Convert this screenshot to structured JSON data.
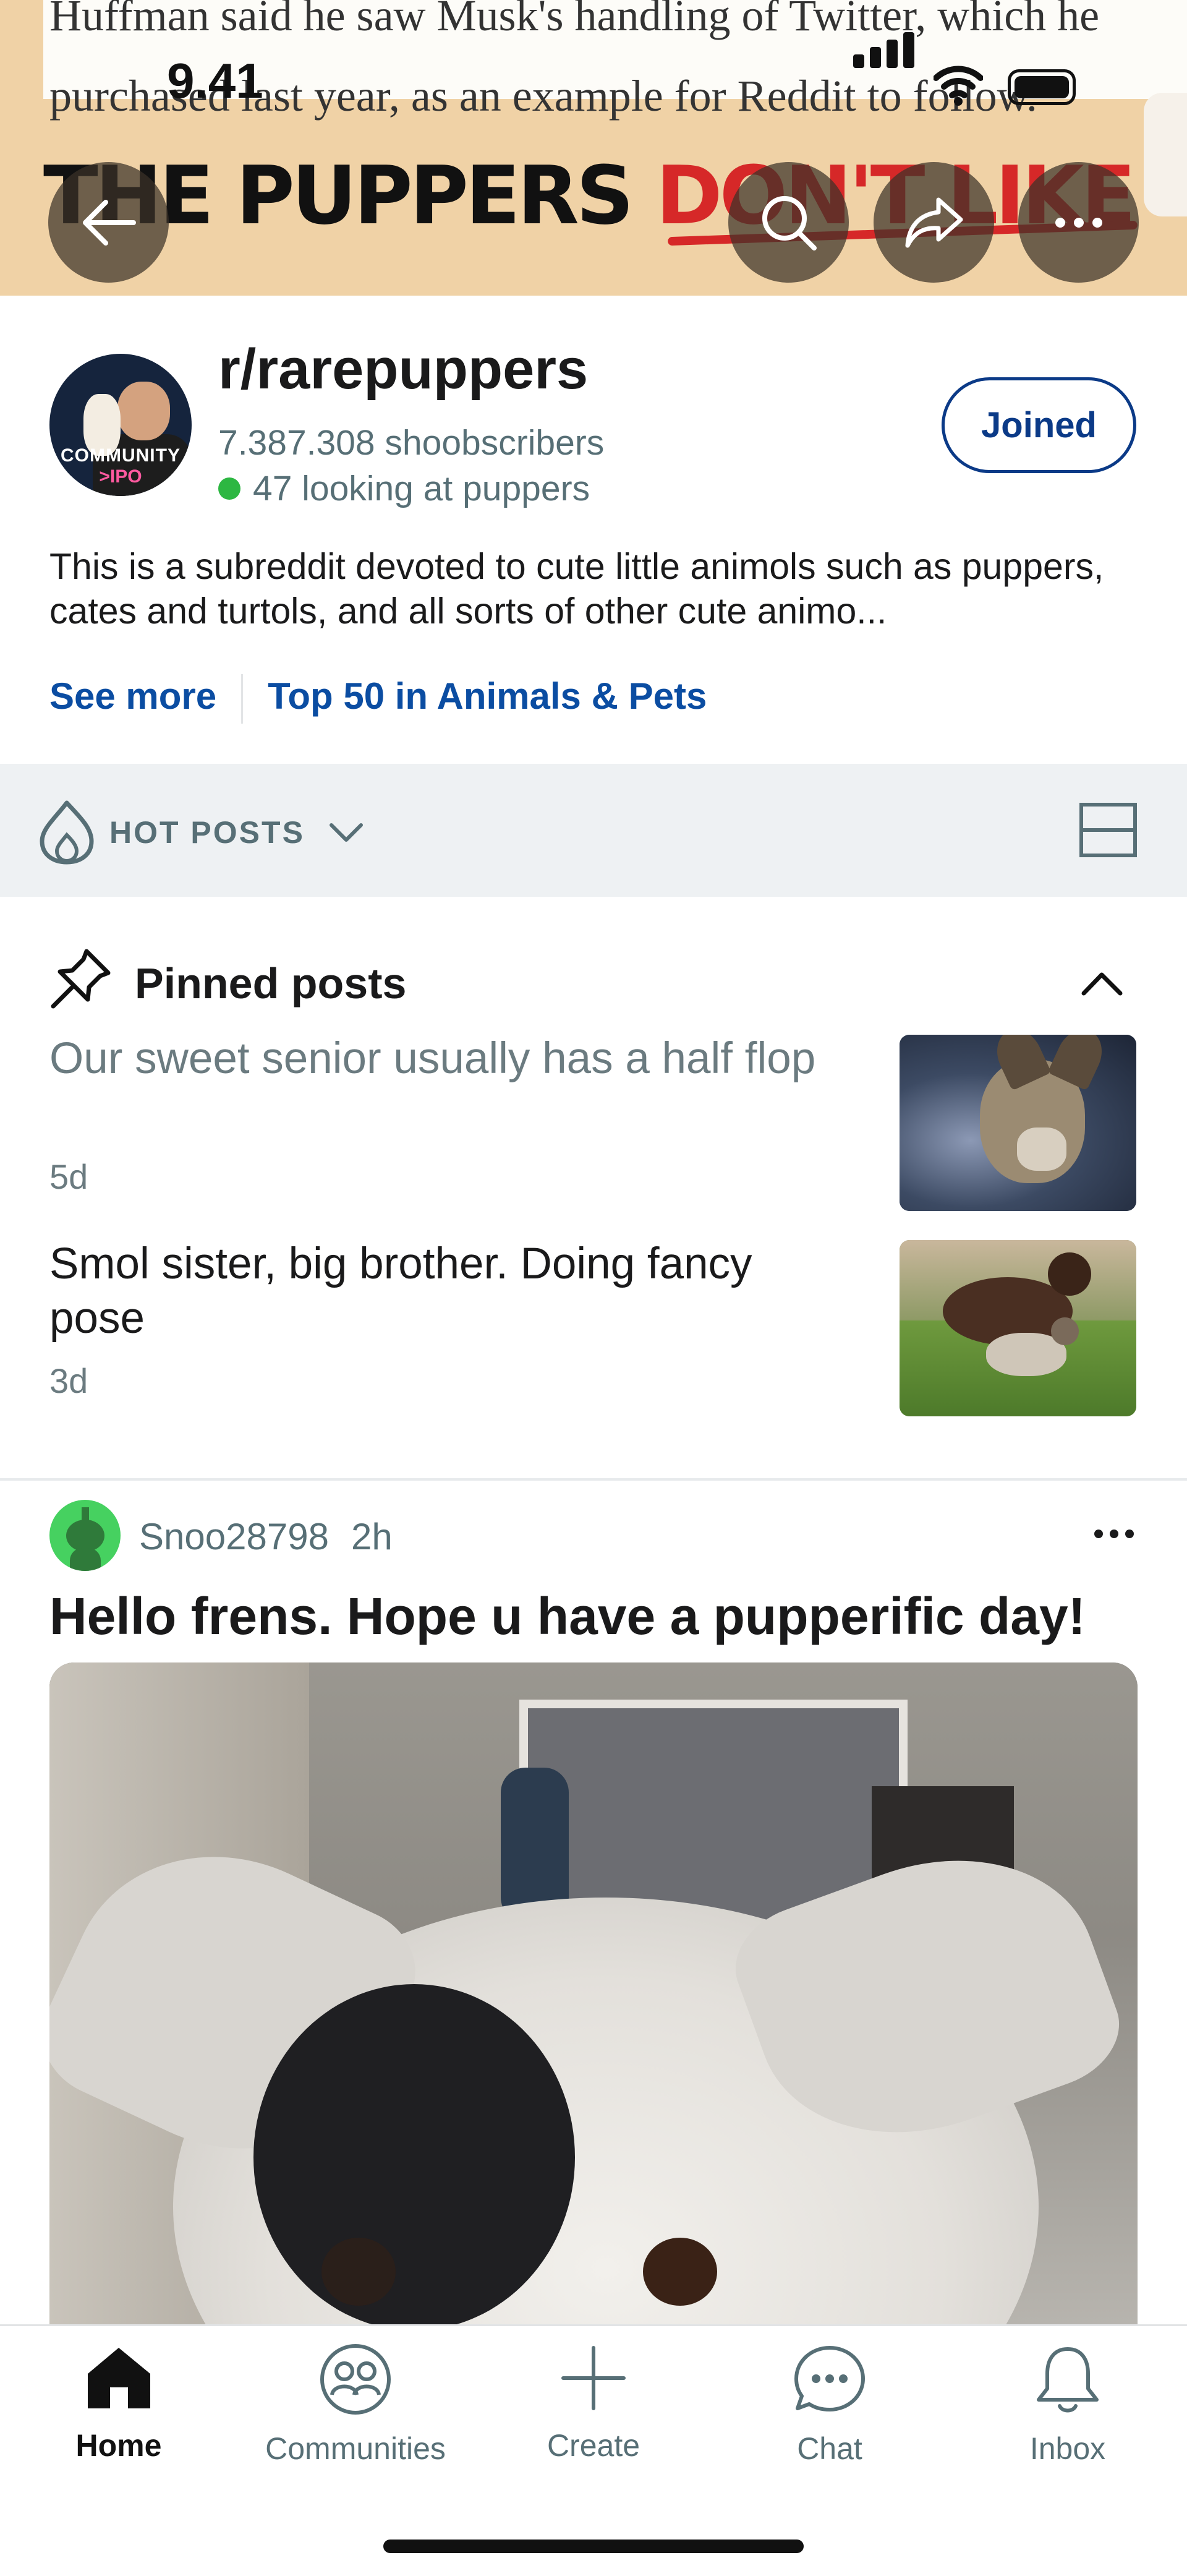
{
  "status_bar": {
    "time": "9.41"
  },
  "banner": {
    "news_line1": "Huffman said he saw Musk's handling of Twitter, which he",
    "news_line2": "purchased last year, as an example for Reddit to follow.",
    "headline_black": "THE PUPPERS ",
    "headline_red": "DON'T LIKE"
  },
  "nav": {
    "back_icon": "back-arrow-icon",
    "search_icon": "search-icon",
    "share_icon": "share-icon",
    "more_icon": "more-icon"
  },
  "community": {
    "avatar_tag1": "COMMUNITY",
    "avatar_tag2": ">IPO",
    "name": "r/rarepuppers",
    "subscribers": "7.387.308 shoobscribers",
    "online": "47 looking at puppers",
    "joined_label": "Joined",
    "description": "This is a subreddit devoted to cute little animols such as puppers, cates and turtols, and all sorts of other cute animo...",
    "see_more": "See more",
    "ranking": "Top 50 in Animals & Pets"
  },
  "sort": {
    "label": "HOT POSTS"
  },
  "pinned": {
    "heading": "Pinned posts",
    "posts": [
      {
        "title": "Our sweet senior usually has a half flop",
        "age": "5d"
      },
      {
        "title": "Smol sister, big brother. Doing fancy pose",
        "age": "3d"
      }
    ]
  },
  "post": {
    "author": "Snoo28798",
    "age": "2h",
    "title": "Hello frens. Hope u have a pupperific day!"
  },
  "tabbar": {
    "tabs": [
      {
        "label": "Home",
        "icon": "home-icon"
      },
      {
        "label": "Communities",
        "icon": "communities-icon"
      },
      {
        "label": "Create",
        "icon": "plus-icon"
      },
      {
        "label": "Chat",
        "icon": "chat-icon"
      },
      {
        "label": "Inbox",
        "icon": "bell-icon"
      }
    ]
  },
  "colors": {
    "accent_blue": "#0b3a87",
    "link_blue": "#0b4da2",
    "online_green": "#2db742",
    "headline_red": "#d62828"
  }
}
